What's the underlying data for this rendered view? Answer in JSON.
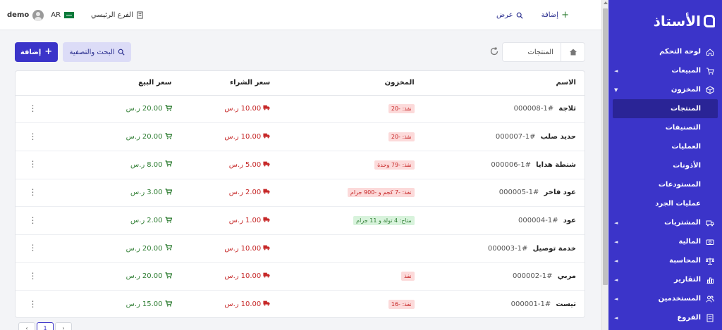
{
  "topbar": {
    "user": "demo",
    "lang": "AR",
    "branch": "الفرع الرئيسي",
    "view_label": "عرض",
    "add_label": "إضافة"
  },
  "sidebar": {
    "logo": "الأستاذ",
    "items": [
      {
        "label": "لوحة التحكم",
        "icon": "home-icon",
        "caret": ""
      },
      {
        "label": "المبيعات",
        "icon": "cart-icon",
        "caret": "◄"
      },
      {
        "label": "المخزون",
        "icon": "box-icon",
        "caret": "▼"
      }
    ],
    "subitems": [
      {
        "label": "المنتجات",
        "active": true
      },
      {
        "label": "التصنيفات"
      },
      {
        "label": "العمليات"
      },
      {
        "label": "الأذونات"
      },
      {
        "label": "المستودعات"
      },
      {
        "label": "عمليات الجرد"
      }
    ],
    "items_after": [
      {
        "label": "المشتريات",
        "icon": "truck-icon",
        "caret": "◄"
      },
      {
        "label": "المالية",
        "icon": "money-icon",
        "caret": "◄"
      },
      {
        "label": "المحاسبة",
        "icon": "scale-icon",
        "caret": "◄"
      },
      {
        "label": "التقارير",
        "icon": "chart-icon",
        "caret": "◄"
      },
      {
        "label": "المستخدمين",
        "icon": "users-icon",
        "caret": "◄"
      },
      {
        "label": "الفروع",
        "icon": "building-icon",
        "caret": "◄"
      }
    ]
  },
  "breadcrumb": {
    "current": "المنتجات"
  },
  "toolbar": {
    "search_label": "البحث والتصفية",
    "add_label": "إضافة"
  },
  "table": {
    "headers": {
      "name": "الاسم",
      "stock": "المخزون",
      "buy": "سعر الشراء",
      "sell": "سعر البيع"
    },
    "currency": "ر.س",
    "rows": [
      {
        "name": "ثلاجة",
        "code": "#1-000008",
        "stock": "نفذ: -20",
        "stock_status": "red",
        "buy": "10.00",
        "sell": "20.00"
      },
      {
        "name": "حديد صلب",
        "code": "#1-000007",
        "stock": "نفذ: -20",
        "stock_status": "red",
        "buy": "10.00",
        "sell": "20.00"
      },
      {
        "name": "شنطة هدايا",
        "code": "#1-000006",
        "stock": "نفذ: -79 وحدة",
        "stock_status": "red",
        "buy": "5.00",
        "sell": "8.00"
      },
      {
        "name": "عود فاخر",
        "code": "#1-000005",
        "stock": "نفذ: -7 كجم و -900 جرام",
        "stock_status": "red",
        "buy": "2.00",
        "sell": "3.00"
      },
      {
        "name": "عود",
        "code": "#1-000004",
        "stock": "متاح: 4 تولة و 11 جرام",
        "stock_status": "green",
        "buy": "1.00",
        "sell": "2.00"
      },
      {
        "name": "خدمة توصيل",
        "code": "#1-000003",
        "stock": "",
        "stock_status": "",
        "buy": "10.00",
        "sell": "20.00"
      },
      {
        "name": "مربي",
        "code": "#1-000002",
        "stock": "نفذ",
        "stock_status": "red",
        "buy": "10.00",
        "sell": "20.00"
      },
      {
        "name": "تيست",
        "code": "#1-000001",
        "stock": "نفذ: -16",
        "stock_status": "red",
        "buy": "10.00",
        "sell": "15.00"
      }
    ]
  },
  "pagination": {
    "prev": "‹",
    "current": "1",
    "next": "›"
  },
  "colors": {
    "primary": "#3b34c9",
    "sidebar_active": "#2a2496",
    "danger": "#c62828",
    "success": "#2e7d32"
  }
}
